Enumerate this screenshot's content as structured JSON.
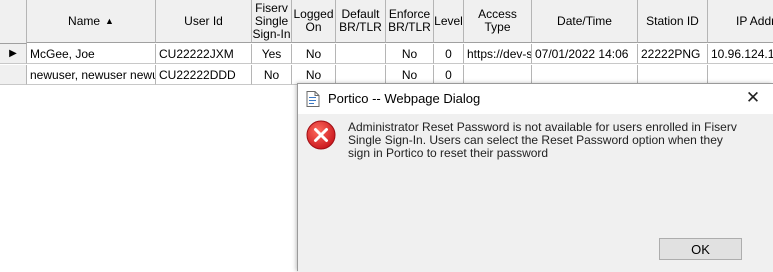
{
  "grid": {
    "columns": [
      {
        "key": "name",
        "label": "Name",
        "sort": "▲"
      },
      {
        "key": "user_id",
        "label": "User Id"
      },
      {
        "key": "sso",
        "label": "Fiserv\nSingle\nSign-In"
      },
      {
        "key": "logged_on",
        "label": "Logged\nOn"
      },
      {
        "key": "default_br",
        "label": "Default\nBR/TLR"
      },
      {
        "key": "enforce_br",
        "label": "Enforce\nBR/TLR"
      },
      {
        "key": "level",
        "label": "Level"
      },
      {
        "key": "access_type",
        "label": "Access\nType"
      },
      {
        "key": "datetime",
        "label": "Date/Time"
      },
      {
        "key": "station_id",
        "label": "Station ID"
      },
      {
        "key": "ip",
        "label": "IP Addr"
      }
    ],
    "rows": [
      {
        "current_marker": "▶",
        "name": "McGee, Joe",
        "user_id": "CU22222JXM",
        "sso": "Yes",
        "logged_on": "No",
        "default_br": "",
        "enforce_br": "No",
        "level": "0",
        "access_type": "https://dev-s",
        "datetime": "07/01/2022 14:06",
        "station_id": "22222PNG",
        "ip": "10.96.124.1"
      },
      {
        "current_marker": "",
        "name": "newuser, newuser newu",
        "user_id": "CU22222DDD",
        "sso": "No",
        "logged_on": "No",
        "default_br": "",
        "enforce_br": "No",
        "level": "0",
        "access_type": "",
        "datetime": "",
        "station_id": "",
        "ip": ""
      }
    ]
  },
  "dialog": {
    "title": "Portico -- Webpage Dialog",
    "message": "Administrator Reset Password is not available for users enrolled in Fiserv Single Sign-In. Users can select the Reset Password option when they sign in Portico to reset their password",
    "ok_label": "OK",
    "close_glyph": "✕",
    "icon": "error-icon",
    "error_color": "#e81123"
  }
}
